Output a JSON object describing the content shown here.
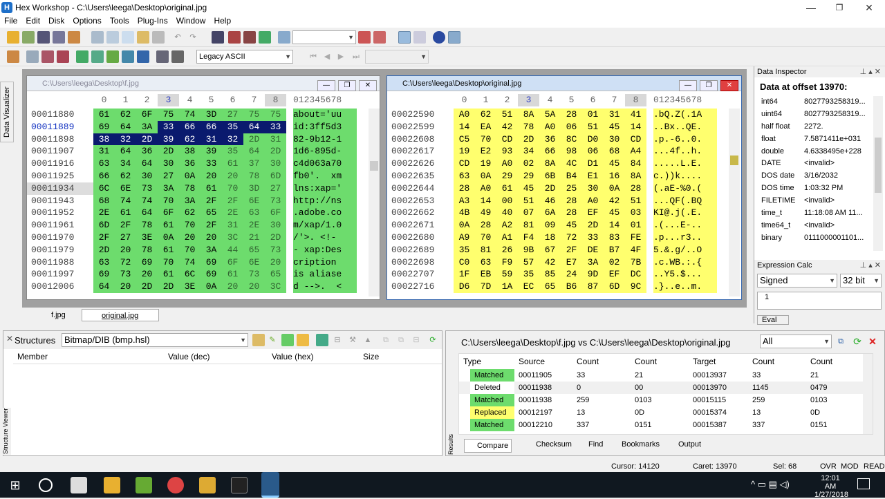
{
  "window": {
    "title": "Hex Workshop - C:\\Users\\leega\\Desktop\\original.jpg",
    "min": "—",
    "max": "❐",
    "close": "✕"
  },
  "menu": [
    "File",
    "Edit",
    "Disk",
    "Options",
    "Tools",
    "Plug-Ins",
    "Window",
    "Help"
  ],
  "toolbar2": {
    "encoding": "Legacy ASCII"
  },
  "side": {
    "data_visualizer": "Data Visualizer",
    "structure_viewer": "Structure Viewer",
    "results": "Results"
  },
  "left_pane": {
    "title": "C:\\Users\\leega\\Desktop\\f.jpg",
    "col_digits": [
      "0",
      "1",
      "2",
      "3",
      "4",
      "5",
      "6",
      "7",
      "8"
    ],
    "ascii_header": "012345678",
    "rows": [
      {
        "off": "00011880",
        "hex": [
          "61",
          "62",
          "6F",
          "75",
          "74",
          "3D",
          "27",
          "75",
          "75"
        ],
        "ascii": "about='uu"
      },
      {
        "off": "00011889",
        "hex": [
          "69",
          "64",
          "3A",
          "33",
          "66",
          "66",
          "35",
          "64",
          "33"
        ],
        "ascii": "id:3ff5d3"
      },
      {
        "off": "00011898",
        "hex": [
          "38",
          "32",
          "2D",
          "39",
          "62",
          "31",
          "32",
          "2D",
          "31"
        ],
        "ascii": "82-9b12-1"
      },
      {
        "off": "00011907",
        "hex": [
          "31",
          "64",
          "36",
          "2D",
          "38",
          "39",
          "35",
          "64",
          "2D"
        ],
        "ascii": "1d6-895d-"
      },
      {
        "off": "00011916",
        "hex": [
          "63",
          "34",
          "64",
          "30",
          "36",
          "33",
          "61",
          "37",
          "30"
        ],
        "ascii": "c4d063a70"
      },
      {
        "off": "00011925",
        "hex": [
          "66",
          "62",
          "30",
          "27",
          "0A",
          "20",
          "20",
          "78",
          "6D"
        ],
        "ascii": "fb0'.  xm"
      },
      {
        "off": "00011934",
        "hex": [
          "6C",
          "6E",
          "73",
          "3A",
          "78",
          "61",
          "70",
          "3D",
          "27"
        ],
        "ascii": "lns:xap='"
      },
      {
        "off": "00011943",
        "hex": [
          "68",
          "74",
          "74",
          "70",
          "3A",
          "2F",
          "2F",
          "6E",
          "73"
        ],
        "ascii": "http://ns"
      },
      {
        "off": "00011952",
        "hex": [
          "2E",
          "61",
          "64",
          "6F",
          "62",
          "65",
          "2E",
          "63",
          "6F"
        ],
        "ascii": ".adobe.co"
      },
      {
        "off": "00011961",
        "hex": [
          "6D",
          "2F",
          "78",
          "61",
          "70",
          "2F",
          "31",
          "2E",
          "30"
        ],
        "ascii": "m/xap/1.0"
      },
      {
        "off": "00011970",
        "hex": [
          "2F",
          "27",
          "3E",
          "0A",
          "20",
          "20",
          "3C",
          "21",
          "2D"
        ],
        "ascii": "/'>. <!-"
      },
      {
        "off": "00011979",
        "hex": [
          "2D",
          "20",
          "78",
          "61",
          "70",
          "3A",
          "44",
          "65",
          "73"
        ],
        "ascii": "- xap:Des"
      },
      {
        "off": "00011988",
        "hex": [
          "63",
          "72",
          "69",
          "70",
          "74",
          "69",
          "6F",
          "6E",
          "20"
        ],
        "ascii": "cription "
      },
      {
        "off": "00011997",
        "hex": [
          "69",
          "73",
          "20",
          "61",
          "6C",
          "69",
          "61",
          "73",
          "65"
        ],
        "ascii": "is aliase"
      },
      {
        "off": "00012006",
        "hex": [
          "64",
          "20",
          "2D",
          "2D",
          "3E",
          "0A",
          "20",
          "20",
          "3C"
        ],
        "ascii": "d -->.  <"
      }
    ]
  },
  "right_pane": {
    "title": "C:\\Users\\leega\\Desktop\\original.jpg",
    "col_digits": [
      "0",
      "1",
      "2",
      "3",
      "4",
      "5",
      "6",
      "7",
      "8"
    ],
    "ascii_header": "012345678",
    "rows": [
      {
        "off": "00022590",
        "hex": [
          "A0",
          "62",
          "51",
          "8A",
          "5A",
          "28",
          "01",
          "31",
          "41"
        ],
        "ascii": ".bQ.Z(.1A"
      },
      {
        "off": "00022599",
        "hex": [
          "14",
          "EA",
          "42",
          "78",
          "A0",
          "06",
          "51",
          "45",
          "14"
        ],
        "ascii": "..Bx..QE."
      },
      {
        "off": "00022608",
        "hex": [
          "C5",
          "70",
          "CD",
          "2D",
          "36",
          "8C",
          "D0",
          "30",
          "CD"
        ],
        "ascii": ".p.-6..0."
      },
      {
        "off": "00022617",
        "hex": [
          "19",
          "E2",
          "93",
          "34",
          "66",
          "98",
          "06",
          "68",
          "A4"
        ],
        "ascii": "...4f..h."
      },
      {
        "off": "00022626",
        "hex": [
          "CD",
          "19",
          "A0",
          "02",
          "8A",
          "4C",
          "D1",
          "45",
          "84"
        ],
        "ascii": ".....L.E."
      },
      {
        "off": "00022635",
        "hex": [
          "63",
          "0A",
          "29",
          "29",
          "6B",
          "B4",
          "E1",
          "16",
          "8A"
        ],
        "ascii": "c.))k...."
      },
      {
        "off": "00022644",
        "hex": [
          "28",
          "A0",
          "61",
          "45",
          "2D",
          "25",
          "30",
          "0A",
          "28"
        ],
        "ascii": "(.aE-%0.("
      },
      {
        "off": "00022653",
        "hex": [
          "A3",
          "14",
          "00",
          "51",
          "46",
          "28",
          "A0",
          "42",
          "51"
        ],
        "ascii": "...QF(.BQ"
      },
      {
        "off": "00022662",
        "hex": [
          "4B",
          "49",
          "40",
          "07",
          "6A",
          "28",
          "EF",
          "45",
          "03"
        ],
        "ascii": "KI@.j(.E."
      },
      {
        "off": "00022671",
        "hex": [
          "0A",
          "28",
          "A2",
          "81",
          "09",
          "45",
          "2D",
          "14",
          "01"
        ],
        "ascii": ".(...E-.."
      },
      {
        "off": "00022680",
        "hex": [
          "A9",
          "70",
          "A1",
          "F4",
          "18",
          "72",
          "33",
          "83",
          "FE"
        ],
        "ascii": ".p...r3.."
      },
      {
        "off": "00022689",
        "hex": [
          "35",
          "81",
          "26",
          "9B",
          "67",
          "2F",
          "DE",
          "B7",
          "4F"
        ],
        "ascii": "5.&.g/..O"
      },
      {
        "off": "00022698",
        "hex": [
          "C0",
          "63",
          "F9",
          "57",
          "42",
          "E7",
          "3A",
          "02",
          "7B"
        ],
        "ascii": ".c.WB.:.{"
      },
      {
        "off": "00022707",
        "hex": [
          "1F",
          "EB",
          "59",
          "35",
          "85",
          "24",
          "9D",
          "EF",
          "DC"
        ],
        "ascii": "..Y5.$..."
      },
      {
        "off": "00022716",
        "hex": [
          "D6",
          "7D",
          "1A",
          "EC",
          "65",
          "B6",
          "87",
          "6D",
          "9C"
        ],
        "ascii": ".}..e..m."
      }
    ]
  },
  "file_tabs": [
    "f.jpg",
    "original.jpg"
  ],
  "inspector": {
    "title": "Data Inspector",
    "offset_label": "Data at offset 13970:",
    "rows": [
      {
        "k": "int64",
        "v": "8027793258319..."
      },
      {
        "k": "uint64",
        "v": "8027793258319..."
      },
      {
        "k": "half float",
        "v": "2272."
      },
      {
        "k": "float",
        "v": "7.5871411e+031"
      },
      {
        "k": "double",
        "v": "4.6338495e+228"
      },
      {
        "k": "DATE",
        "v": "<invalid>"
      },
      {
        "k": "DOS date",
        "v": "3/16/2032"
      },
      {
        "k": "DOS time",
        "v": "1:03:32 PM"
      },
      {
        "k": "FILETIME",
        "v": "<invalid>"
      },
      {
        "k": "time_t",
        "v": "11:18:08 AM 11..."
      },
      {
        "k": "time64_t",
        "v": "<invalid>"
      },
      {
        "k": "binary",
        "v": "0111000001101..."
      }
    ]
  },
  "expr": {
    "title": "Expression Calc",
    "signed": "Signed",
    "bits": "32 bit",
    "line": "1",
    "eval": "Eval"
  },
  "structures": {
    "label": "Structures",
    "selected": "Bitmap/DIB  (bmp.hsl)",
    "cols": [
      "Member",
      "Value (dec)",
      "Value (hex)",
      "Size"
    ]
  },
  "results": {
    "title": "C:\\Users\\leega\\Desktop\\f.jpg vs C:\\Users\\leega\\Desktop\\original.jpg",
    "filter": "All",
    "cols": [
      "Type",
      "Source",
      "Count",
      "Count",
      "Target",
      "Count",
      "Count"
    ],
    "rows": [
      {
        "type": "Matched",
        "source": "00011905",
        "c1": "33",
        "c2": "21",
        "target": "00013937",
        "c3": "33",
        "c4": "21"
      },
      {
        "type": "Deleted",
        "source": "00011938",
        "c1": "0",
        "c2": "00",
        "target": "00013970",
        "c3": "1145",
        "c4": "0479"
      },
      {
        "type": "Matched",
        "source": "00011938",
        "c1": "259",
        "c2": "0103",
        "target": "00015115",
        "c3": "259",
        "c4": "0103"
      },
      {
        "type": "Replaced",
        "source": "00012197",
        "c1": "13",
        "c2": "0D",
        "target": "00015374",
        "c3": "13",
        "c4": "0D"
      },
      {
        "type": "Matched",
        "source": "00012210",
        "c1": "337",
        "c2": "0151",
        "target": "00015387",
        "c3": "337",
        "c4": "0151"
      }
    ],
    "tabs": [
      "Compare",
      "Checksum",
      "Find",
      "Bookmarks",
      "Output"
    ]
  },
  "status": {
    "cursor": "Cursor: 14120",
    "caret": "Caret: 13970",
    "sel": "Sel: 68",
    "ovr": "OVR",
    "mod": "MOD",
    "read": "READ"
  },
  "taskbar": {
    "time": "12:01 AM",
    "date": "1/27/2018"
  }
}
